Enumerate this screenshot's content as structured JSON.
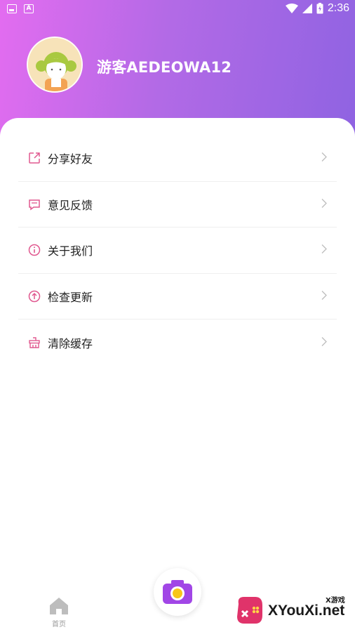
{
  "status_bar": {
    "time": "2:36"
  },
  "profile": {
    "username": "游客AEDEOWA12"
  },
  "menu": {
    "items": [
      {
        "label": "分享好友",
        "icon": "share-icon"
      },
      {
        "label": "意见反馈",
        "icon": "feedback-icon"
      },
      {
        "label": "关于我们",
        "icon": "info-icon"
      },
      {
        "label": "检查更新",
        "icon": "update-icon"
      },
      {
        "label": "清除缓存",
        "icon": "clear-cache-icon"
      }
    ]
  },
  "tabbar": {
    "home_label": "首页",
    "camera_icon": "camera-icon"
  },
  "watermark": {
    "text": "XYouXi.net",
    "small_text": "X游戏"
  },
  "colors": {
    "header_start": "#e36cf0",
    "header_end": "#8f63e2",
    "icon_pink": "#e0588f",
    "camera_purple": "#a146e6",
    "camera_lens": "#f7c61b"
  }
}
